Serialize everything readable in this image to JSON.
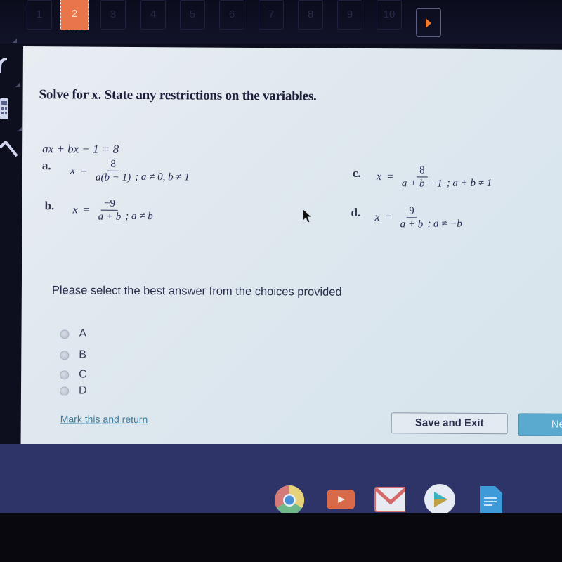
{
  "tabstrip": {
    "tabs": [
      {
        "label": "1",
        "active": false
      },
      {
        "label": "2",
        "active": true
      },
      {
        "label": "3",
        "active": false
      },
      {
        "label": "4",
        "active": false
      },
      {
        "label": "5",
        "active": false
      },
      {
        "label": "6",
        "active": false
      },
      {
        "label": "7",
        "active": false
      },
      {
        "label": "8",
        "active": false
      },
      {
        "label": "9",
        "active": false
      },
      {
        "label": "10",
        "active": false
      }
    ],
    "next_icon": "play-triangle-icon",
    "active_color": "#e8764a"
  },
  "question": {
    "prompt_pre": "Solve for ",
    "prompt_var": "x",
    "prompt_post": ". State any restrictions on the variables.",
    "given_equation": "ax + bx − 1 = 8",
    "options": [
      {
        "letter": "a.",
        "lhs": "x",
        "eq": "=",
        "numerator": "8",
        "denominator": "a(b − 1)",
        "restriction": "; a ≠ 0, b ≠ 1"
      },
      {
        "letter": "b.",
        "lhs": "x",
        "eq": "=",
        "numerator": "−9",
        "denominator": "a + b",
        "restriction": "; a ≠ b"
      },
      {
        "letter": "c.",
        "lhs": "x",
        "eq": "=",
        "numerator": "8",
        "denominator": "a + b − 1",
        "restriction": "; a + b ≠ 1"
      },
      {
        "letter": "d.",
        "lhs": "x",
        "eq": "=",
        "numerator": "9",
        "denominator": "a + b",
        "restriction": "; a ≠ −b"
      }
    ]
  },
  "answer": {
    "instruction": "Please select the best answer from the choices provided",
    "choices": [
      {
        "label": "A",
        "selected": false
      },
      {
        "label": "B",
        "selected": false
      },
      {
        "label": "C",
        "selected": false
      },
      {
        "label": "D",
        "selected": false
      }
    ]
  },
  "footer": {
    "mark_link": "Mark this and return",
    "save_exit": "Save and Exit",
    "next_partial": "Ne"
  },
  "shelf": {
    "apps": [
      "chrome-icon",
      "youtube-icon",
      "gmail-icon",
      "play-store-icon",
      "docs-icon"
    ]
  }
}
